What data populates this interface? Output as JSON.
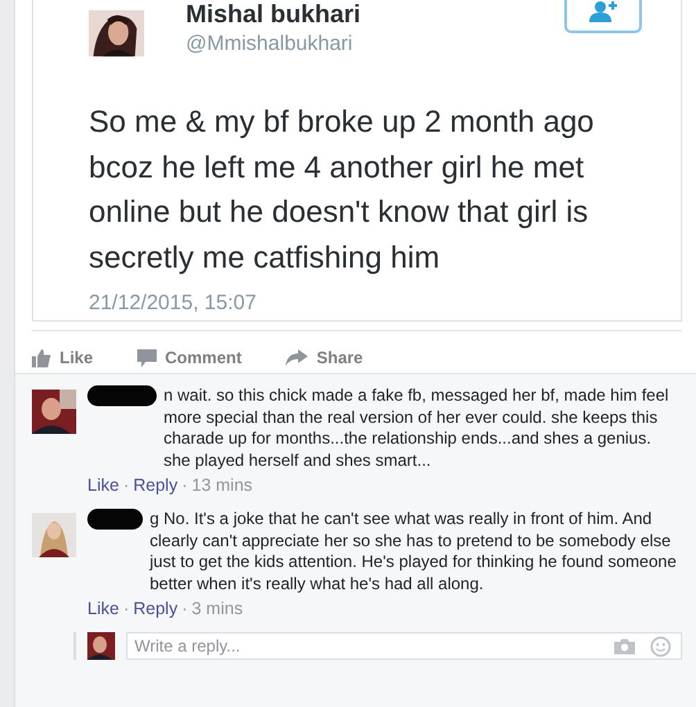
{
  "tweet": {
    "name": "Mishal bukhari",
    "handle": "@Mmishalbukhari",
    "text_lines": [
      "So me & my bf broke up 2 month ago",
      "bcoz he left me 4 another girl he met",
      "online  but he doesn't know that girl is",
      "secretly me catfishing him"
    ],
    "timestamp": "21/12/2015, 15:07"
  },
  "actions": [
    "Like",
    "Comment",
    "Share"
  ],
  "comments": [
    {
      "text": "n wait. so this chick made a fake fb, messaged her bf, made him feel more special than the real version of her ever could. she keeps this charade up for months...the relationship ends...and shes a genius. she played herself and shes smart...",
      "like": "Like",
      "sep1": "·",
      "reply": "Reply",
      "sep2": "·",
      "time": "13 mins"
    },
    {
      "text": "g No. It's a joke that he can't see what was really in front of him. And clearly can't appreciate her so she has to pretend to be somebody else just to get the kids attention. He's played for thinking he found someone better when it's really what he's had all along.",
      "like": "Like",
      "sep1": "·",
      "reply": "Reply",
      "sep2": "·",
      "time": "3 mins"
    }
  ],
  "reply_box": {
    "placeholder": "Write a reply..."
  }
}
